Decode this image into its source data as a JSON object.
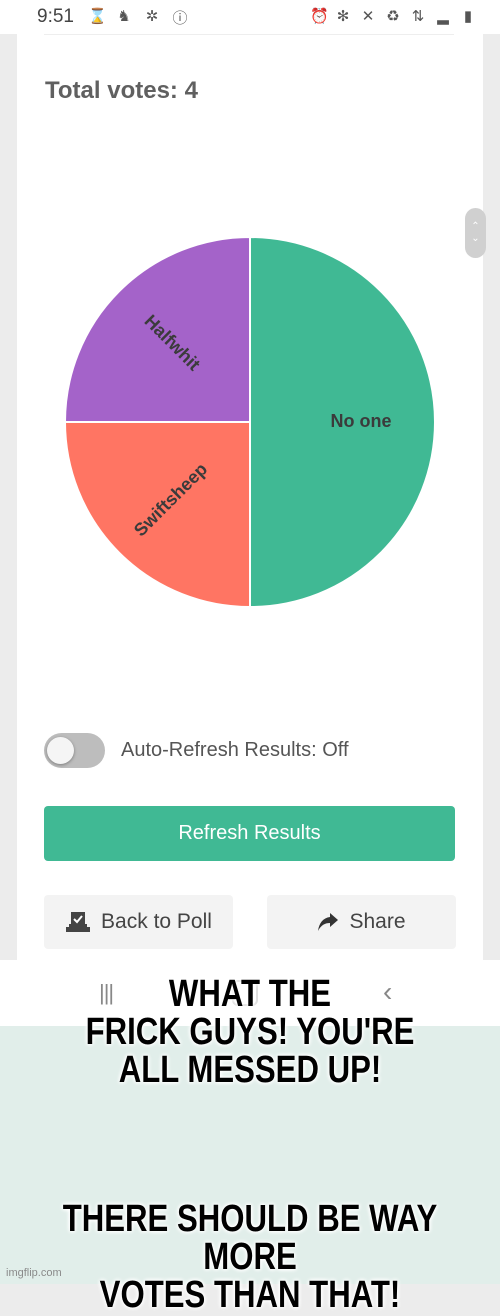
{
  "status_bar": {
    "time": "9:51",
    "left_icons": [
      "hourglass-icon",
      "notification-app-icon",
      "network-hub-icon",
      "alert-circle-icon"
    ],
    "right_icons": [
      "alarm-icon",
      "bluetooth-icon",
      "mute-icon",
      "battery-saver-icon",
      "4g-lte-icon",
      "signal-icon",
      "battery-icon"
    ]
  },
  "poll": {
    "total_votes_label": "Total votes: 4"
  },
  "chart_data": {
    "type": "pie",
    "title": "",
    "slices": [
      {
        "label": "No one",
        "value": 2,
        "color": "#40b994"
      },
      {
        "label": "Swiftsheep",
        "value": 1,
        "color": "#ff7563"
      },
      {
        "label": "Halfwhit",
        "value": 1,
        "color": "#a463c9"
      }
    ],
    "start_angle": "12 o'clock, clockwise",
    "legend": "none",
    "label_color": "#3b3b3b"
  },
  "controls": {
    "auto_refresh_label": "Auto-Refresh Results: Off",
    "auto_refresh_on": false,
    "refresh_button": "Refresh Results",
    "back_button": "Back to Poll",
    "share_button": "Share",
    "accent_color": "#40b994"
  },
  "scroll_handle": {
    "up": "⌃",
    "down": "⌄"
  },
  "nav_bar": {
    "recents": "|||",
    "back": "‹"
  },
  "meme": {
    "top_text": [
      "WHAT THE",
      "FRICK GUYS! YOU'RE",
      "ALL MESSED UP!"
    ],
    "bottom_text": [
      "THERE SHOULD BE WAY MORE",
      "VOTES THAN THAT!"
    ],
    "watermark": "imgflip.com"
  }
}
